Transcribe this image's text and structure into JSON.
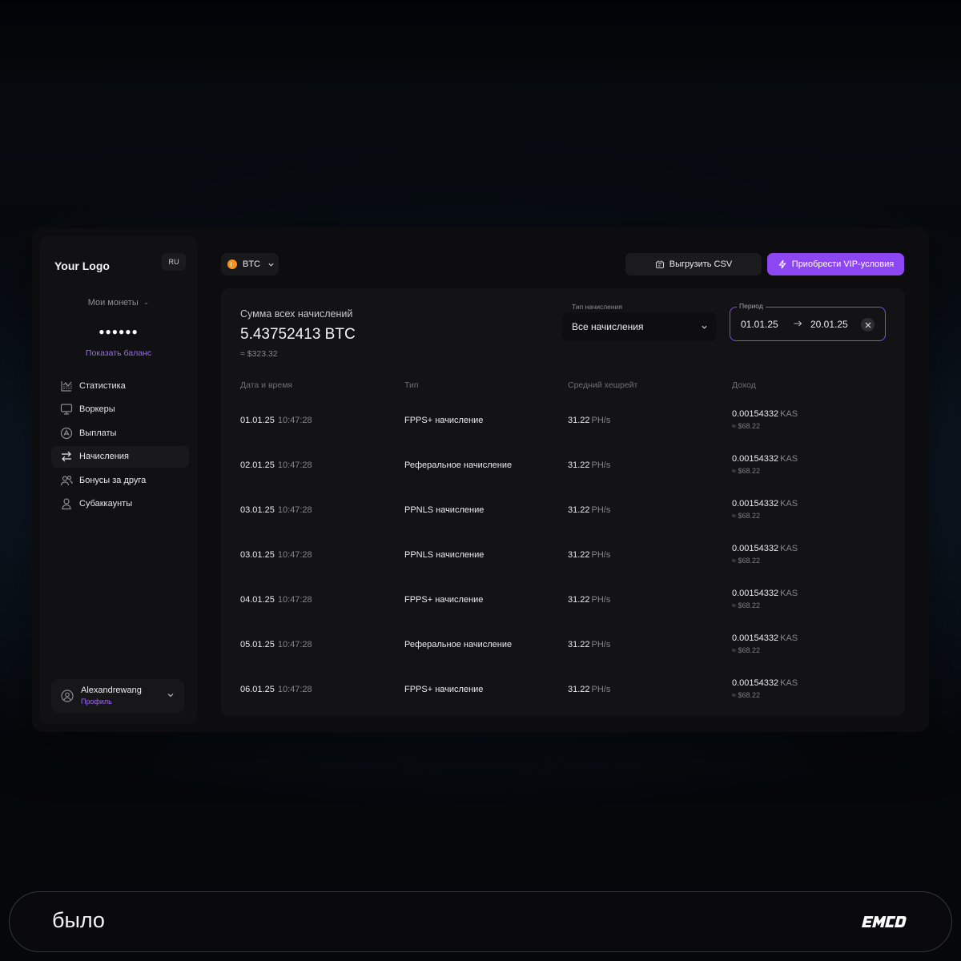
{
  "sidebar": {
    "logo": "Your Logo",
    "lang": "RU",
    "coins_label": "Мои монеты",
    "balance_mask": "●●●●●●",
    "show_balance": "Показать баланс",
    "nav": [
      {
        "label": "Статистика",
        "icon": "chart-icon",
        "active": false
      },
      {
        "label": "Воркеры",
        "icon": "monitor-icon",
        "active": false
      },
      {
        "label": "Выплаты",
        "icon": "payout-icon",
        "active": false
      },
      {
        "label": "Начисления",
        "icon": "transfer-icon",
        "active": true
      },
      {
        "label": "Бонусы за друга",
        "icon": "users-icon",
        "active": false
      },
      {
        "label": "Субаккаунты",
        "icon": "user-icon",
        "active": false
      }
    ],
    "profile": {
      "name": "Alexandrewang",
      "link": "Профиль"
    }
  },
  "topbar": {
    "coin": "BTC",
    "csv_button": "Выгрузить CSV",
    "vip_button": "Приобрести VIP-условия"
  },
  "summary": {
    "label": "Сумма всех начислений",
    "value": "5.43752413 BTC",
    "usd": "≈ $323.32"
  },
  "filters": {
    "type_label": "Тип начисления",
    "type_value": "Все начисления",
    "period_label": "Период",
    "period_from": "01.01.25",
    "period_to": "20.01.25"
  },
  "table": {
    "headers": [
      "Дата и время",
      "Тип",
      "Средний хешрейт",
      "Доход"
    ],
    "rows": [
      {
        "date": "01.01.25",
        "time": "10:47:28",
        "type": "FPPS+ начисление",
        "hash": "31.22",
        "hash_unit": "PH/s",
        "income": "0.00154332",
        "income_unit": "KAS",
        "usd": "≈ $68.22"
      },
      {
        "date": "02.01.25",
        "time": "10:47:28",
        "type": "Реферальное начисление",
        "hash": "31.22",
        "hash_unit": "PH/s",
        "income": "0.00154332",
        "income_unit": "KAS",
        "usd": "≈ $68.22"
      },
      {
        "date": "03.01.25",
        "time": "10:47:28",
        "type": "PPNLS начисление",
        "hash": "31.22",
        "hash_unit": "PH/s",
        "income": "0.00154332",
        "income_unit": "KAS",
        "usd": "≈ $68.22"
      },
      {
        "date": "03.01.25",
        "time": "10:47:28",
        "type": "PPNLS начисление",
        "hash": "31.22",
        "hash_unit": "PH/s",
        "income": "0.00154332",
        "income_unit": "KAS",
        "usd": "≈ $68.22"
      },
      {
        "date": "04.01.25",
        "time": "10:47:28",
        "type": "FPPS+ начисление",
        "hash": "31.22",
        "hash_unit": "PH/s",
        "income": "0.00154332",
        "income_unit": "KAS",
        "usd": "≈ $68.22"
      },
      {
        "date": "05.01.25",
        "time": "10:47:28",
        "type": "Реферальное начисление",
        "hash": "31.22",
        "hash_unit": "PH/s",
        "income": "0.00154332",
        "income_unit": "KAS",
        "usd": "≈ $68.22"
      },
      {
        "date": "06.01.25",
        "time": "10:47:28",
        "type": "FPPS+ начисление",
        "hash": "31.22",
        "hash_unit": "PH/s",
        "income": "0.00154332",
        "income_unit": "KAS",
        "usd": "≈ $68.22"
      }
    ]
  },
  "bottom": {
    "word": "было",
    "brand": "EMCD"
  },
  "colors": {
    "accent": "#8d47f2",
    "link": "#9b6cf6",
    "btc": "#f7931a"
  }
}
